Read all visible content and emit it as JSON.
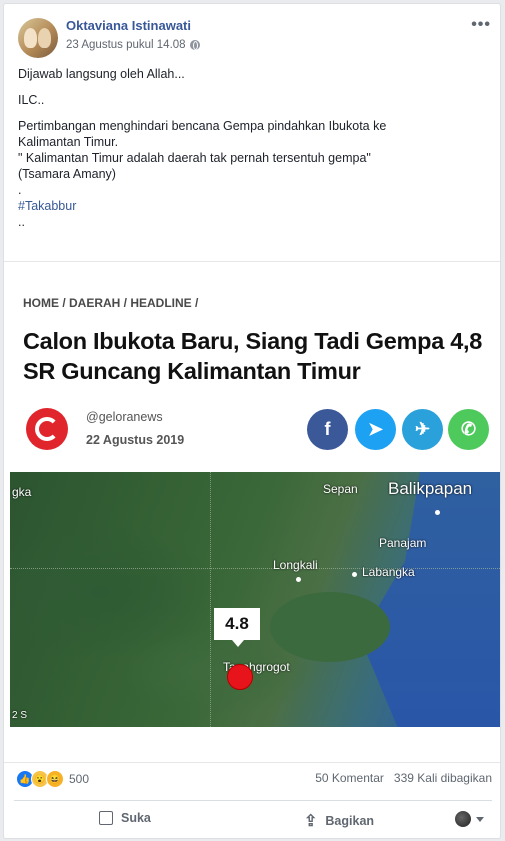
{
  "author": {
    "name": "Oktaviana Istinawati",
    "timestamp": "23 Agustus pukul 14.08"
  },
  "post": {
    "lines": [
      "Dijawab langsung oleh Allah...",
      "ILC..",
      "Pertimbangan menghindari bencana Gempa pindahkan Ibukota ke",
      "Kalimantan Timur.",
      "\" Kalimantan Timur adalah daerah tak pernah tersentuh gempa\"",
      "(Tsamara Amany)",
      ".",
      "#Takabbur",
      ".."
    ]
  },
  "article": {
    "breadcrumb": "HOME / DAERAH / HEADLINE /",
    "title": "Calon Ibukota Baru, Siang Tadi Gempa 4,8 SR Guncang Kalimantan Timur",
    "source": "@geloranews",
    "date": "22 Agustus 2019",
    "share_icons": [
      "facebook-icon",
      "twitter-icon",
      "telegram-icon",
      "whatsapp-icon"
    ],
    "map": {
      "labels": [
        "gka",
        "Sepan",
        "Balikpapan",
        "Panajam",
        "Longkali",
        "Labangka",
        "Tanahgrogot",
        "2 S"
      ],
      "magnitude": "4.8"
    }
  },
  "stats": {
    "reactions": "500",
    "comments": "50 Komentar",
    "shares": "339 Kali dibagikan"
  },
  "actions": {
    "like": "Suka",
    "share": "Bagikan"
  },
  "colors": {
    "link": "#385898",
    "quake": "#e8141b",
    "logo": "#e0252c"
  }
}
